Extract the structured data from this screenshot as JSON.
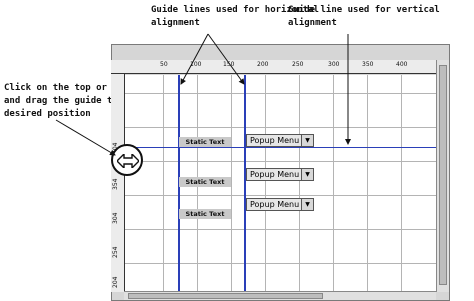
{
  "callouts": {
    "horizontal": "Guide lines used for horizontal\nalignment",
    "vertical": "Guide line used for vertical\nalignment",
    "drag": "Click on the top or left ruler\nand drag the guide to the\ndesired position"
  },
  "ruler": {
    "top_labels": [
      "50",
      "100",
      "150",
      "200",
      "250",
      "300",
      "350",
      "400"
    ],
    "left_labels": [
      "404",
      "354",
      "304",
      "254",
      "204"
    ]
  },
  "controls": {
    "static_texts": [
      "Static Text",
      "Static Text",
      "Static Text"
    ],
    "popups": [
      {
        "label": "Popup Menu",
        "arrow": "▼"
      },
      {
        "label": "Popup Menu",
        "arrow": "▼"
      },
      {
        "label": "Popup Menu",
        "arrow": "▼"
      }
    ]
  },
  "icons": {
    "drag_cursor": "double-arrow-icon"
  },
  "colors": {
    "guide": "#2a3fb8",
    "grid": "#b4b4b4",
    "static_text_bg": "#c9c9c9"
  }
}
